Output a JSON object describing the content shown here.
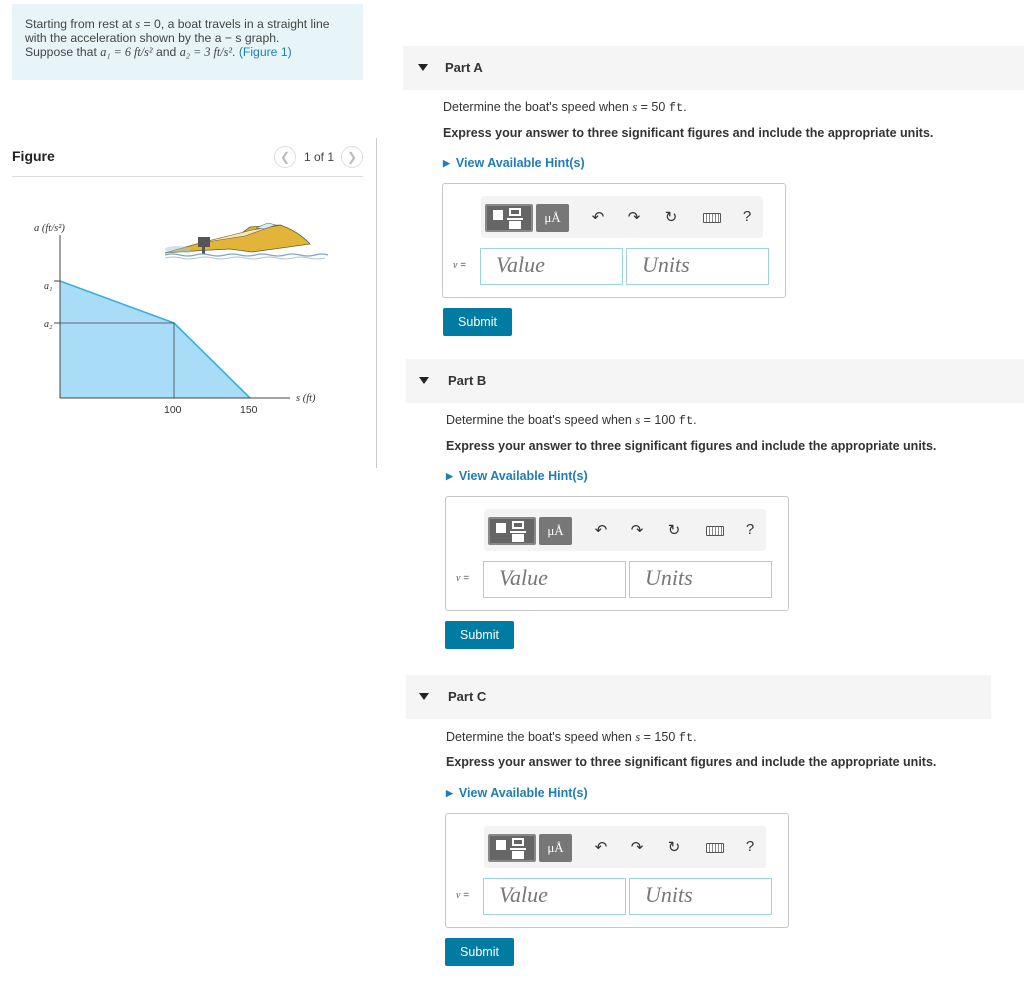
{
  "problem": {
    "line1_pre": "Starting from rest at ",
    "line1_var": "s",
    "line1_post": " = 0, a boat travels in a straight line",
    "line2": "with the acceleration shown by the a − s graph.",
    "line3_pre": "Suppose that ",
    "a1_expr": "a₁ = 6 ft/s²",
    "and": " and ",
    "a2_expr": "a₂ = 3 ft/s²",
    "line3_post": ". ",
    "figure_link": "(Figure 1)"
  },
  "figure": {
    "title": "Figure",
    "pager_text": "1 of 1",
    "prev_icon": "chevron-left-icon",
    "next_icon": "chevron-right-icon"
  },
  "graph": {
    "y_axis_label": "a (ft/s²)",
    "x_axis_label": "s (ft)",
    "y_tick_a1": "a₁",
    "y_tick_a2": "a₂",
    "x_tick_100": "100",
    "x_tick_150": "150",
    "fill_color": "#a9dcf7",
    "line_color": "#39aee0",
    "boat_color": "#e3b43a"
  },
  "parts": [
    {
      "label": "Part A",
      "question_pre": "Determine the boat's speed when ",
      "question_var": "s",
      "question_post": " = 50 ",
      "question_unit": "ft",
      "question_end": ".",
      "instruction": "Express your answer to three significant figures and include the appropriate units.",
      "hint": "View Available Hint(s)",
      "var_label": "v",
      "eq": " =",
      "value_placeholder": "Value",
      "units_placeholder": "Units",
      "submit": "Submit"
    },
    {
      "label": "Part B",
      "question_pre": "Determine the boat's speed when ",
      "question_var": "s",
      "question_post": " = 100 ",
      "question_unit": "ft",
      "question_end": ".",
      "instruction": "Express your answer to three significant figures and include the appropriate units.",
      "hint": "View Available Hint(s)",
      "var_label": "v",
      "eq": " =",
      "value_placeholder": "Value",
      "units_placeholder": "Units",
      "submit": "Submit"
    },
    {
      "label": "Part C",
      "question_pre": "Determine the boat's speed when ",
      "question_var": "s",
      "question_post": " = 150 ",
      "question_unit": "ft",
      "question_end": ".",
      "instruction": "Express your answer to three significant figures and include the appropriate units.",
      "hint": "View Available Hint(s)",
      "var_label": "v",
      "eq": " =",
      "value_placeholder": "Value",
      "units_placeholder": "Units",
      "submit": "Submit"
    }
  ],
  "toolbar": {
    "units_button": "μÅ",
    "undo_icon": "↶",
    "redo_icon": "↷",
    "reset_icon": "↻",
    "help_icon": "?",
    "template_icon": "templates-icon",
    "keyboard_icon": "keyboard-icon"
  },
  "colors": {
    "accent": "#1f7db8",
    "submit_bg": "#007ca2",
    "problem_bg": "#e7f5f8"
  }
}
